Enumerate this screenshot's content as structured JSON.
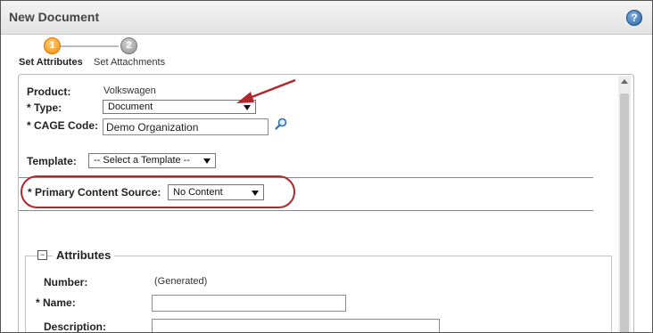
{
  "window": {
    "title": "New Document",
    "help_icon": "help-icon"
  },
  "wizard": {
    "steps": [
      {
        "number": "1",
        "label": "Set Attributes",
        "state": "active"
      },
      {
        "number": "2",
        "label": "Set Attachments",
        "state": "inactive"
      }
    ]
  },
  "form": {
    "product": {
      "label": "Product:",
      "value": "Volkswagen"
    },
    "type": {
      "label": "* Type:",
      "value": "Document"
    },
    "cage_code": {
      "label": "* CAGE Code:",
      "value": "Demo Organization",
      "lookup_icon": "magnifier-icon"
    },
    "template": {
      "label": "Template:",
      "value": "-- Select a Template --"
    },
    "primary_content_source": {
      "label": "* Primary Content Source:",
      "value": "No Content"
    }
  },
  "attributes": {
    "title": "Attributes",
    "number": {
      "label": "Number:",
      "value": "(Generated)"
    },
    "name": {
      "label": "* Name:",
      "value": ""
    },
    "description": {
      "label": "Description:",
      "value": ""
    }
  },
  "annotations": {
    "highlight_color": "#b3262c",
    "arrow_color": "#b3262c"
  }
}
